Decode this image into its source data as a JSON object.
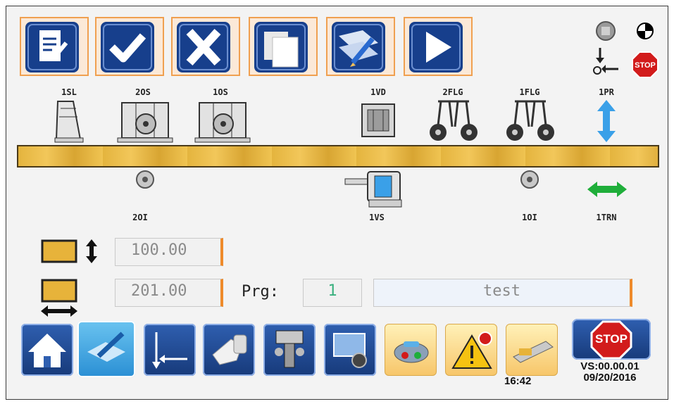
{
  "toolbar": {
    "buttons": [
      {
        "name": "edit-document-button",
        "icon": "edit-document-icon"
      },
      {
        "name": "confirm-button",
        "icon": "checkmark-icon"
      },
      {
        "name": "cancel-button",
        "icon": "x-icon"
      },
      {
        "name": "copy-button",
        "icon": "copy-pages-icon"
      },
      {
        "name": "edit-plan-button",
        "icon": "pencil-map-icon"
      },
      {
        "name": "play-button",
        "icon": "play-icon"
      }
    ]
  },
  "status_icons": {
    "top_left": "gray-square-circle-icon",
    "top_right": "black-white-quadrant-circle-icon",
    "bottom_left": "sensor-arrow-icon",
    "bottom_right": "stop-sign-icon",
    "stop_text": "STOP"
  },
  "stations_top": [
    {
      "label": "1SL",
      "icon": "saw-blade-icon"
    },
    {
      "label": "2OS",
      "icon": "router-station-icon"
    },
    {
      "label": "1OS",
      "icon": "router-station-icon"
    },
    {
      "label": "1VD",
      "icon": "vertical-drill-icon"
    },
    {
      "label": "2FLG",
      "icon": "clamp-wheels-icon"
    },
    {
      "label": "1FLG",
      "icon": "clamp-wheels-icon"
    },
    {
      "label": "1PR",
      "icon": "up-down-arrow-icon"
    }
  ],
  "stations_bottom": [
    {
      "label": "2OI",
      "icon": "bit-icon"
    },
    {
      "label": "1VS",
      "icon": "vertical-saw-icon"
    },
    {
      "label": "1OI",
      "icon": "bit-icon"
    },
    {
      "label": "1TRN",
      "icon": "left-right-arrow-icon"
    }
  ],
  "height_value": "100.00",
  "length_value": "201.00",
  "program": {
    "label": "Prg:",
    "value": "1",
    "name": "test"
  },
  "bottom_bar": [
    {
      "name": "home-button",
      "icon": "home-icon",
      "style": "blue"
    },
    {
      "name": "edit-program-button",
      "icon": "pencil-board-icon",
      "style": "sel"
    },
    {
      "name": "axis-position-button",
      "icon": "axis-arrows-icon",
      "style": "blue"
    },
    {
      "name": "manual-button",
      "icon": "hand-pointer-icon",
      "style": "blue"
    },
    {
      "name": "tools-button",
      "icon": "drill-tools-icon",
      "style": "blue"
    },
    {
      "name": "machine-setup-button",
      "icon": "monitor-gear-icon",
      "style": "blue"
    },
    {
      "name": "io-button",
      "icon": "io-device-icon",
      "style": "yellow"
    },
    {
      "name": "alarms-button",
      "icon": "warning-icon",
      "style": "yellow"
    },
    {
      "name": "conveyor-button",
      "icon": "conveyor-icon",
      "style": "yellow"
    }
  ],
  "stop_button_label": "STOP",
  "clock": "16:42",
  "version": "VS:00.00.01",
  "date": "09/20/2016",
  "colors": {
    "accent": "#ee8a2a",
    "button_blue": "#1d4a9a",
    "board": "#e4b43e",
    "arrow_blue": "#3aa0e8",
    "arrow_green": "#1fae3a",
    "stop_red": "#d21b1b"
  }
}
